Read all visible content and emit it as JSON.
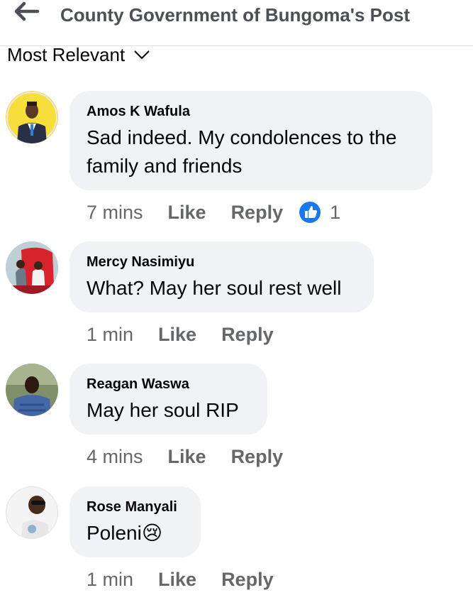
{
  "header": {
    "title": "County Government of Bungoma's Post"
  },
  "sort": {
    "label": "Most Relevant"
  },
  "comments": [
    {
      "author": "Amos K Wafula",
      "text": "Sad indeed. My condolences to the family and friends",
      "time": "7 mins",
      "like_label": "Like",
      "reply_label": "Reply",
      "reaction_count": "1"
    },
    {
      "author": "Mercy Nasimiyu",
      "text": "What? May her soul rest well",
      "time": "1 min",
      "like_label": "Like",
      "reply_label": "Reply"
    },
    {
      "author": "Reagan Waswa",
      "text": "May her soul RIP",
      "time": "4 mins",
      "like_label": "Like",
      "reply_label": "Reply"
    },
    {
      "author": "Rose Manyali",
      "text": "Poleni😢",
      "time": "1 min",
      "like_label": "Like",
      "reply_label": "Reply"
    }
  ],
  "colors": {
    "bubble": "#f0f2f5",
    "meta": "#65676b",
    "like_blue": "#1877f2"
  }
}
